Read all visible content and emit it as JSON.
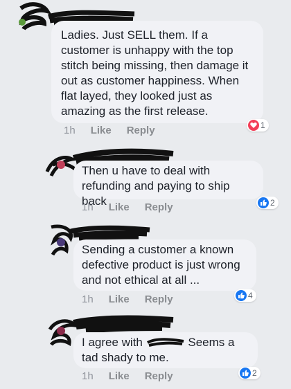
{
  "comments": [
    {
      "text": "Ladies. Just SELL them. If a customer is unhappy with the top stitch being missing, then damage it out as customer happiness. When flat layed, they looked just as amazing as the first release.",
      "time": "1h",
      "like_label": "Like",
      "reply_label": "Reply",
      "reaction_count": "1",
      "reaction_type": "heart-icon",
      "reaction_color": "#f33e58"
    },
    {
      "text": "Then u have to deal with refunding and paying to ship back",
      "time": "1h",
      "like_label": "Like",
      "reply_label": "Reply",
      "reaction_count": "2",
      "reaction_type": "thumbs-up-icon",
      "reaction_color": "#1877f2"
    },
    {
      "text": "Sending a customer a known defective product is just wrong and not ethical at all ...",
      "time": "1h",
      "like_label": "Like",
      "reply_label": "Reply",
      "reaction_count": "4",
      "reaction_type": "thumbs-up-icon",
      "reaction_color": "#1877f2"
    },
    {
      "text_before": "I agree with",
      "text_after": "Seems a tad shady to me.",
      "time": "1h",
      "like_label": "Like",
      "reply_label": "Reply",
      "reaction_count": "2",
      "reaction_type": "thumbs-up-icon",
      "reaction_color": "#1877f2"
    }
  ]
}
